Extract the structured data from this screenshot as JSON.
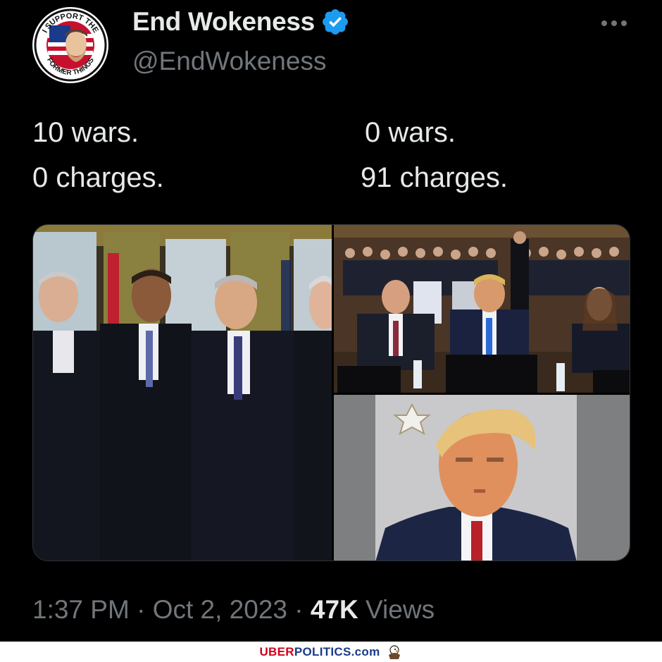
{
  "profile": {
    "display_name": "End Wokeness",
    "handle": "@EndWokeness",
    "avatar_top_text": "I SUPPORT THE",
    "avatar_bottom_text": "FORMER THINGS"
  },
  "tweet": {
    "left_line1": "10 wars.",
    "left_line2": "0 charges.",
    "right_line1": "0 wars.",
    "right_line2": "91 charges."
  },
  "meta": {
    "time": "1:37 PM",
    "sep1": " · ",
    "date": "Oct 2, 2023",
    "sep2": " · ",
    "views_count": "47K",
    "views_label": " Views"
  },
  "watermark": {
    "part1": "UBER",
    "part2": "POLITICS.com"
  },
  "colors": {
    "background": "#000000",
    "text": "#e7e9ea",
    "muted": "#71767b",
    "verified": "#1d9bf0"
  }
}
